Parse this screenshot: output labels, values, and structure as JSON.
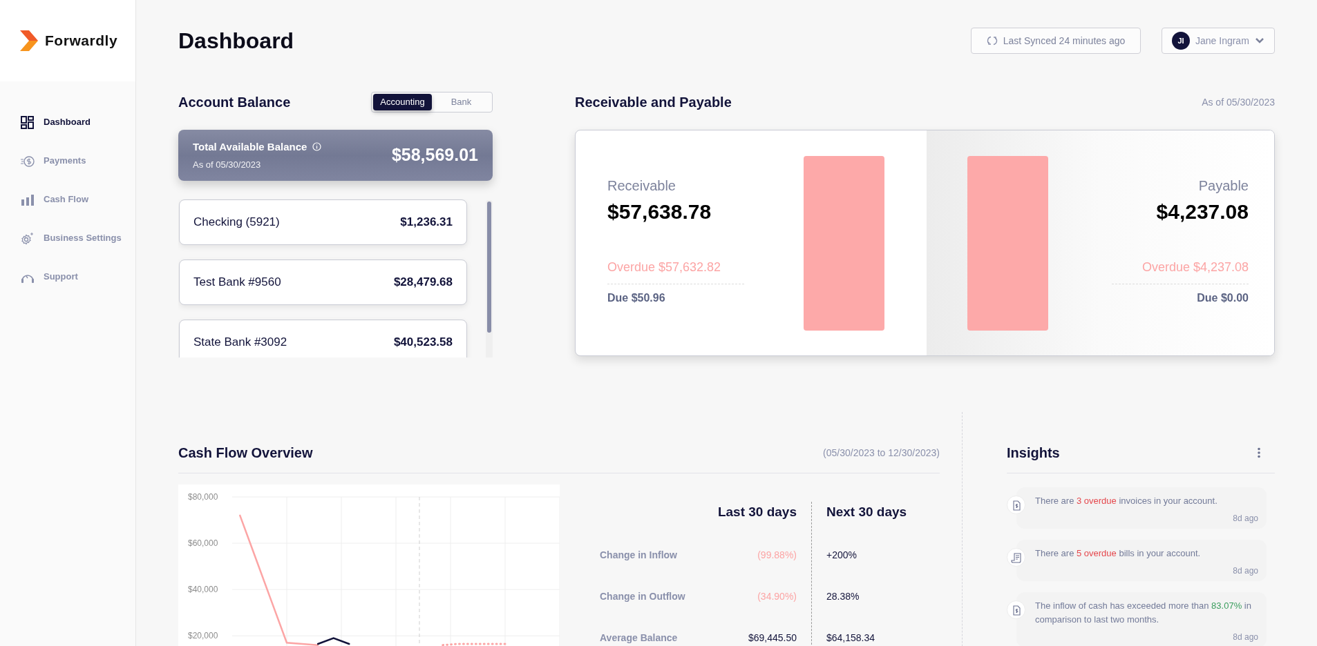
{
  "brand": {
    "name": "Forwardly"
  },
  "sidebar": {
    "items": [
      {
        "label": "Dashboard",
        "selected": true
      },
      {
        "label": "Payments",
        "selected": false
      },
      {
        "label": "Cash Flow",
        "selected": false
      },
      {
        "label": "Business Settings",
        "selected": false
      },
      {
        "label": "Support",
        "selected": false
      }
    ]
  },
  "header": {
    "title": "Dashboard",
    "sync": "Last Synced 24 minutes ago",
    "user": {
      "initials": "JI",
      "name": "Jane Ingram"
    }
  },
  "account_balance": {
    "title": "Account Balance",
    "tabs": [
      {
        "label": "Accounting",
        "selected": true
      },
      {
        "label": "Bank",
        "selected": false
      }
    ],
    "total": {
      "label": "Total Available Balance",
      "date": "As of 05/30/2023",
      "amount": "$58,569.01"
    },
    "accounts": [
      {
        "name": "Checking (5921)",
        "amount": "$1,236.31"
      },
      {
        "name": "Test Bank #9560",
        "amount": "$28,479.68"
      },
      {
        "name": "State Bank #3092",
        "amount": "$40,523.58"
      }
    ]
  },
  "receivable_payable": {
    "title": "Receivable and Payable",
    "date": "As of 05/30/2023",
    "sides": [
      {
        "label": "Receivable",
        "amount": "$57,638.78",
        "overdue": "Overdue $57,632.82",
        "due": "Due $50.96"
      },
      {
        "label": "Payable",
        "amount": "$4,237.08",
        "overdue": "Overdue $4,237.08",
        "due": "Due $0.00"
      }
    ]
  },
  "cash_flow": {
    "title": "Cash Flow Overview",
    "range": "(05/30/2023 to 12/30/2023)",
    "chart_data": {
      "type": "line",
      "grid": true,
      "ylim": [
        15000,
        80000
      ],
      "categories": [
        null,
        null,
        null,
        null,
        null,
        null,
        null,
        null,
        null,
        null,
        null,
        null,
        null,
        null,
        null,
        null,
        null,
        null,
        null,
        null,
        null
      ],
      "yticks": [
        {
          "value": 20000,
          "label": "$20,000"
        },
        {
          "value": 40000,
          "label": "$40,000"
        },
        {
          "value": 60000,
          "label": "$60,000"
        },
        {
          "value": 80000,
          "label": "$80,000"
        }
      ],
      "series": [
        {
          "color": "#fca5a5",
          "values": [
            72000,
            53700,
            35300,
            17000,
            16500,
            16000,
            null,
            null,
            null,
            null,
            null,
            null,
            null,
            null,
            null,
            null,
            null,
            null,
            null,
            null,
            null
          ]
        },
        {
          "color": "#12133a",
          "values": [
            null,
            null,
            null,
            null,
            null,
            16500,
            19000,
            16500,
            null,
            null,
            null,
            null,
            null,
            null,
            null,
            null,
            null,
            null,
            null,
            null,
            null
          ]
        },
        {
          "color": "#fca5a5",
          "line_style": "dotted",
          "values": [
            null,
            null,
            null,
            null,
            null,
            null,
            null,
            null,
            null,
            null,
            null,
            null,
            null,
            16000,
            16500,
            16500,
            16500,
            16500,
            null,
            null,
            null
          ]
        }
      ]
    },
    "stats": {
      "columns": [
        "Last 30 days",
        "Next 30 days"
      ],
      "rows": [
        {
          "label": "Change in Inflow",
          "last": "(99.88%)",
          "last_negative": true,
          "next": "+200%"
        },
        {
          "label": "Change in Outflow",
          "last": "(34.90%)",
          "last_negative": true,
          "next": "28.38%"
        },
        {
          "label": "Average Balance",
          "last": "$69,445.50",
          "last_negative": false,
          "next": "$64,158.34"
        }
      ]
    }
  },
  "insights": {
    "title": "Insights",
    "items": [
      {
        "time": "8d ago",
        "parts": [
          {
            "text": "There are ",
            "kind": "plain"
          },
          {
            "text": "3 overdue",
            "kind": "alert"
          },
          {
            "text": " invoices in your account.",
            "kind": "plain"
          }
        ]
      },
      {
        "time": "8d ago",
        "parts": [
          {
            "text": "There are ",
            "kind": "plain"
          },
          {
            "text": "5 overdue",
            "kind": "alert"
          },
          {
            "text": " bills in your account.",
            "kind": "plain"
          }
        ]
      },
      {
        "time": "8d ago",
        "parts": [
          {
            "text": "The inflow of cash has exceeded more than ",
            "kind": "plain"
          },
          {
            "text": "83.07%",
            "kind": "good"
          },
          {
            "text": " in comparison to last two months.",
            "kind": "plain"
          }
        ]
      }
    ]
  }
}
